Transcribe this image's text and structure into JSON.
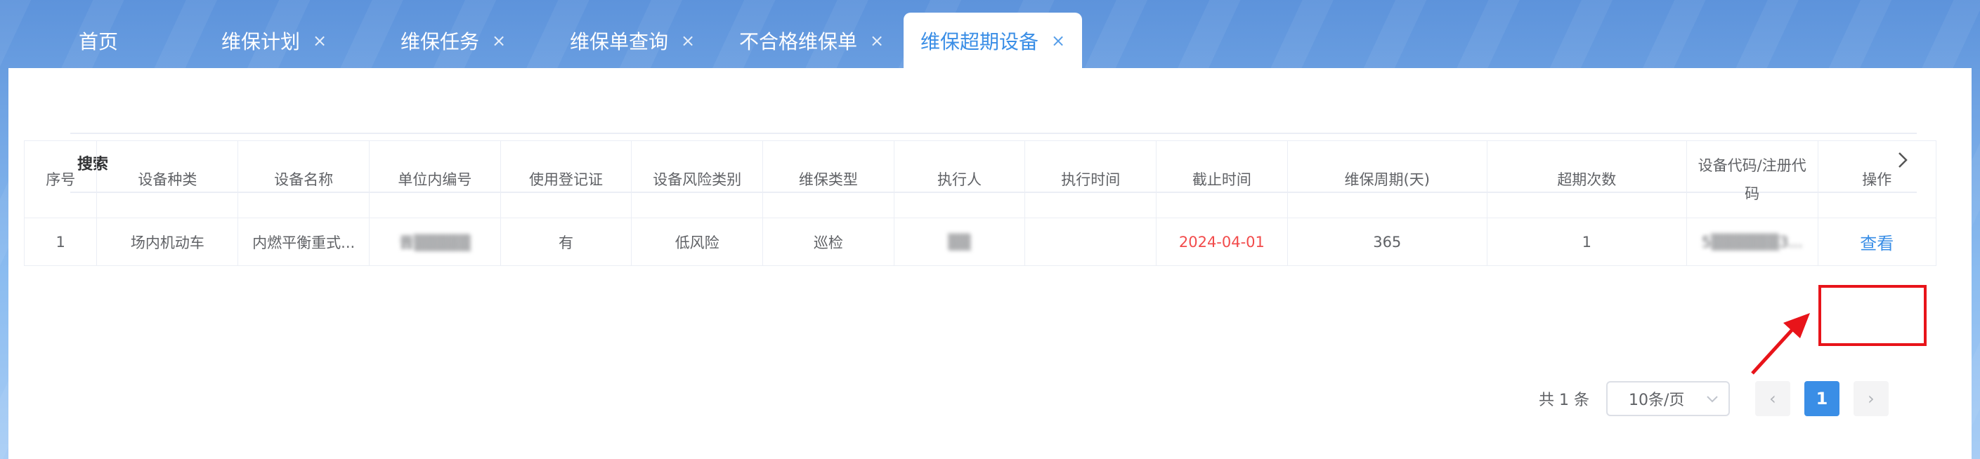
{
  "tabs": [
    {
      "label": "首页",
      "closable": false,
      "active": false
    },
    {
      "label": "维保计划",
      "closable": true,
      "active": false
    },
    {
      "label": "维保任务",
      "closable": true,
      "active": false
    },
    {
      "label": "维保单查询",
      "closable": true,
      "active": false
    },
    {
      "label": "不合格维保单",
      "closable": true,
      "active": false
    },
    {
      "label": "维保超期设备",
      "closable": true,
      "active": true
    }
  ],
  "close_glyph": "×",
  "search": {
    "label": "搜索",
    "icon": "chevron-right-icon"
  },
  "table": {
    "headers": [
      "序号",
      "设备种类",
      "设备名称",
      "单位内编号",
      "使用登记证",
      "设备风险类别",
      "维保类型",
      "执行人",
      "执行时间",
      "截止时间",
      "维保周期(天)",
      "超期次数",
      "设备代码/注册代码",
      "操作"
    ],
    "rows": [
      {
        "index": "1",
        "category": "场内机动车",
        "name": "内燃平衡重式...",
        "unit_no": "晋▒▒▒▒▒",
        "registration": "有",
        "risk": "低风险",
        "maint_type": "巡检",
        "executor": "▒▒",
        "exec_time": "",
        "deadline": "2024-04-01",
        "cycle_days": "365",
        "overdue_count": "1",
        "device_code": "5▒▒▒▒▒▒3...",
        "action": "查看"
      }
    ]
  },
  "pager": {
    "total": "共 1 条",
    "page_size": "10条/页",
    "prev": "‹",
    "current": "1",
    "next": "›"
  },
  "colors": {
    "accent": "#3a8ee6",
    "deadline": "#f24b4b",
    "highlight": "#e8141a"
  }
}
